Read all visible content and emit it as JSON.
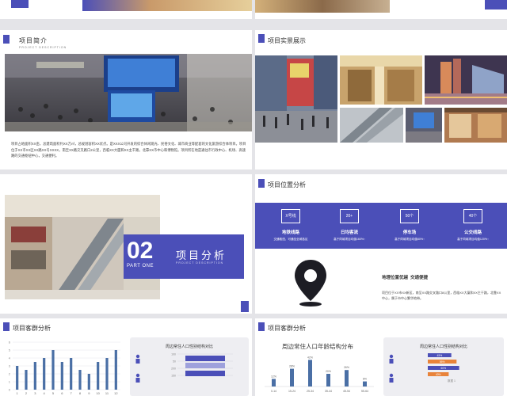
{
  "slide_intro": {
    "title": "项目简介",
    "subtitle": "PROJECT DESCRIPTION",
    "body": "项目占地面积XX亩，总建筑面积约XX万㎡，总规划容积XX优点。是XXX公司开发的综合休闲观光、民俗文化、城市商业等配套的文化旅游综合体项目。项目位于XX市XX区XX路XX号XXXX，南至XX路交叉路口2公里，西临XX大厦和XX主干路，北靠XX市中心和博物馆。项目所在地是通往市行政中心、机场、高速路的交通枢纽中心，交通便利。"
  },
  "slide_gallery": {
    "title": "项目实景展示"
  },
  "slide_section": {
    "number": "02",
    "part": "PART ONE",
    "title": "项目分析",
    "subtitle": "PROJECT DESCRIPTION"
  },
  "slide_location": {
    "title": "项目位置分析",
    "items": [
      {
        "badge": "X号线",
        "label": "地铁线路",
        "desc": "交通枢纽，可通至全城各区"
      },
      {
        "badge": "20+",
        "label": "日均客流",
        "desc": "高于同城项目均值160%↑"
      },
      {
        "badge": "50个",
        "label": "停车场",
        "desc": "高于同城项目均值80%↑"
      },
      {
        "badge": "40个",
        "label": "公交线路",
        "desc": "高于同城项目均值120%↑"
      }
    ],
    "headline": "地理位置优越  交通便捷",
    "desc": "项目位于XX市XX新区，南至XX路交叉路口8公里，西临XX大厦和XX主干路，北靠XX中心，属于市中心繁华地带。"
  },
  "slide_customers_left": {
    "title": "项目客群分析",
    "chart_data": {
      "type": "bar",
      "categories": [
        "1",
        "2",
        "3",
        "4",
        "5",
        "6",
        "7",
        "8",
        "9",
        "10",
        "11",
        "12"
      ],
      "values": [
        3,
        2.5,
        3.5,
        4,
        5,
        3.5,
        4,
        2.5,
        2,
        3.5,
        4,
        5
      ],
      "ylim": [
        0,
        6
      ],
      "yticks": [
        "0",
        "1",
        "2",
        "3",
        "4",
        "5",
        "6"
      ]
    },
    "card_title": "周边常住人口性别结构对比",
    "card_ticks": [
      "100",
      "50",
      "200",
      "150"
    ]
  },
  "slide_customers_right": {
    "title": "项目客群分析",
    "chart_title": "周边常住人口年龄结构分布",
    "chart_data": {
      "type": "bar",
      "categories": [
        "0-14",
        "15-24",
        "25-34",
        "35-44",
        "45-54",
        "55-64"
      ],
      "values": [
        12,
        28,
        42,
        20,
        26,
        8
      ],
      "labels": [
        "12%",
        "28%",
        "42%",
        "20%",
        "26%",
        "8%"
      ],
      "ylim": [
        0,
        50
      ]
    },
    "card_title": "周边常住人口性别结构对比",
    "card_rows": [
      "45%",
      "55%",
      "60%",
      "40%"
    ],
    "card_footer": "数据 1"
  },
  "colors": {
    "accent": "#4b4fb8",
    "orange": "#e8833a",
    "steel": "#4a6fa5"
  }
}
